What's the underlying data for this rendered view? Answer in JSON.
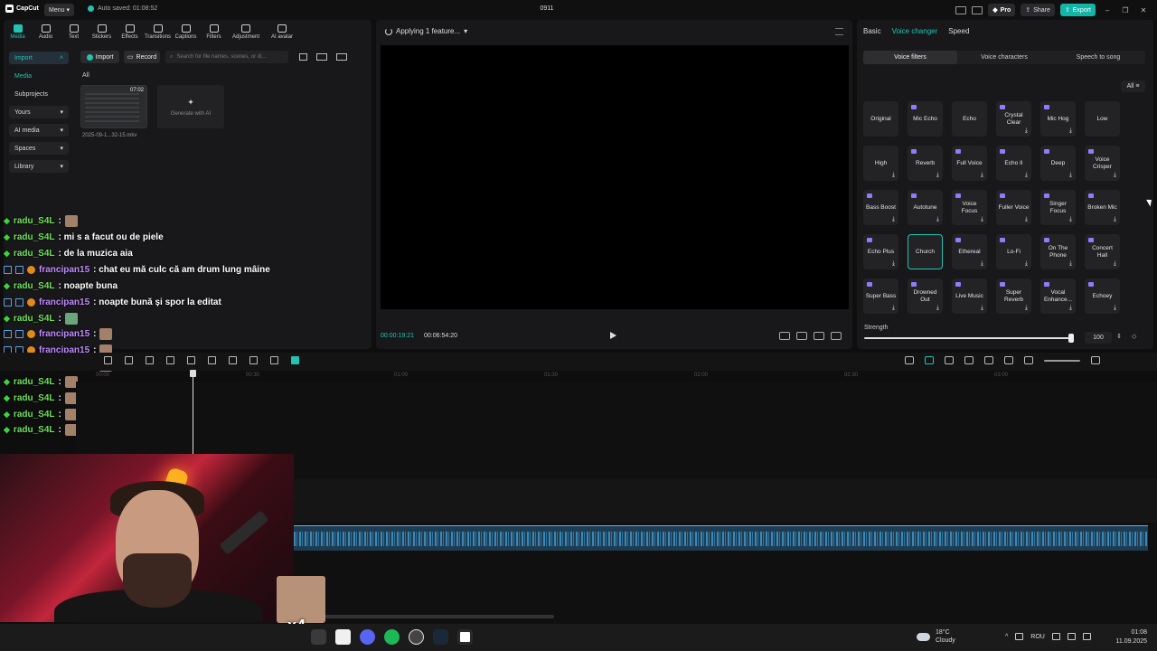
{
  "titlebar": {
    "app_name": "CapCut",
    "menu_label": "Menu",
    "autosave": "Auto saved: 01:08:52",
    "project_name": "0911",
    "pro_label": "Pro",
    "share_label": "Share",
    "export_label": "Export"
  },
  "toolbar": {
    "items": [
      {
        "label": "Media"
      },
      {
        "label": "Audio"
      },
      {
        "label": "Text"
      },
      {
        "label": "Stickers"
      },
      {
        "label": "Effects"
      },
      {
        "label": "Transitions"
      },
      {
        "label": "Captions"
      },
      {
        "label": "Filters"
      },
      {
        "label": "Adjustment"
      },
      {
        "label": "AI avatar"
      }
    ]
  },
  "sidebar": {
    "items": [
      {
        "label": "Import"
      },
      {
        "label": "Media"
      },
      {
        "label": "Subprojects"
      },
      {
        "label": "Yours"
      },
      {
        "label": "AI media"
      },
      {
        "label": "Spaces"
      },
      {
        "label": "Library"
      }
    ]
  },
  "media": {
    "import_label": "Import",
    "record_label": "Record",
    "search_placeholder": "Search for file names, scenes, or di...",
    "all_label": "All",
    "clip_duration": "07:02",
    "clip_name": "2025-09-1...32-15.mkv",
    "generate_label": "Generate with AI"
  },
  "chat": [
    {
      "user": "radu_S4L",
      "text": ":",
      "type": "radu"
    },
    {
      "user": "radu_S4L",
      "text": ": mi s a facut ou de piele",
      "type": "radu"
    },
    {
      "user": "radu_S4L",
      "text": ": de la muzica aia",
      "type": "radu"
    },
    {
      "user": "francipan15",
      "text": ": chat eu mă culc că am drum lung mâine",
      "type": "fran"
    },
    {
      "user": "radu_S4L",
      "text": ": noapte buna",
      "type": "radu"
    },
    {
      "user": "francipan15",
      "text": ": noapte bună și spor la editat",
      "type": "fran"
    },
    {
      "user": "radu_S4L",
      "text": ":",
      "type": "radu"
    },
    {
      "user": "francipan15",
      "text": ":",
      "type": "fran"
    },
    {
      "user": "francipan15",
      "text": ":",
      "type": "fran"
    },
    {
      "user": "francipan15",
      "text": ":",
      "type": "fran"
    },
    {
      "user": "radu_S4L",
      "text": ":",
      "type": "radu"
    },
    {
      "user": "radu_S4L",
      "text": ":",
      "type": "radu"
    },
    {
      "user": "radu_S4L",
      "text": ":",
      "type": "radu"
    },
    {
      "user": "radu_S4L",
      "text": ":",
      "type": "radu"
    }
  ],
  "player": {
    "status": "Applying 1 feature...",
    "current_time": "00:00:19:21",
    "total_time": "00:06:54:20"
  },
  "right_panel": {
    "tabs": [
      {
        "label": "Basic"
      },
      {
        "label": "Voice changer"
      },
      {
        "label": "Speed"
      }
    ],
    "subtabs": [
      {
        "label": "Voice filters"
      },
      {
        "label": "Voice characters"
      },
      {
        "label": "Speech to song"
      }
    ],
    "filter_all": "All",
    "voices": [
      {
        "label": "Original",
        "pro": false,
        "dl": false
      },
      {
        "label": "Mic Echo",
        "pro": true,
        "dl": false
      },
      {
        "label": "Echo",
        "pro": false,
        "dl": false
      },
      {
        "label": "Crystal Clear",
        "pro": true,
        "dl": true
      },
      {
        "label": "Mic Hog",
        "pro": true,
        "dl": true
      },
      {
        "label": "Low",
        "pro": false,
        "dl": false
      },
      {
        "label": "High",
        "pro": false,
        "dl": true
      },
      {
        "label": "Reverb",
        "pro": true,
        "dl": true
      },
      {
        "label": "Full Voice",
        "pro": true,
        "dl": true
      },
      {
        "label": "Echo II",
        "pro": true,
        "dl": true
      },
      {
        "label": "Deep",
        "pro": true,
        "dl": true
      },
      {
        "label": "Voice Crisper",
        "pro": true,
        "dl": true
      },
      {
        "label": "Bass Boost",
        "pro": true,
        "dl": true
      },
      {
        "label": "Autotune",
        "pro": true,
        "dl": true
      },
      {
        "label": "Voice Focus",
        "pro": true,
        "dl": true
      },
      {
        "label": "Fuller Voice",
        "pro": true,
        "dl": true
      },
      {
        "label": "Singer Focus",
        "pro": true,
        "dl": true
      },
      {
        "label": "Broken Mic",
        "pro": true,
        "dl": true
      },
      {
        "label": "Echo Plus",
        "pro": true,
        "dl": true
      },
      {
        "label": "Church",
        "pro": false,
        "dl": false,
        "selected": true
      },
      {
        "label": "Ethereal",
        "pro": true,
        "dl": true
      },
      {
        "label": "Lo-Fi",
        "pro": true,
        "dl": true
      },
      {
        "label": "On The Phone",
        "pro": true,
        "dl": true
      },
      {
        "label": "Concert Hall",
        "pro": true,
        "dl": true
      },
      {
        "label": "Super Bass",
        "pro": true,
        "dl": true
      },
      {
        "label": "Drowned Out",
        "pro": true,
        "dl": true
      },
      {
        "label": "Live Music",
        "pro": true,
        "dl": true
      },
      {
        "label": "Super Reverb",
        "pro": true,
        "dl": true
      },
      {
        "label": "Vocal Enhance...",
        "pro": true,
        "dl": true
      },
      {
        "label": "Echoey",
        "pro": true,
        "dl": true
      }
    ],
    "strength_label": "Strength",
    "strength_value": "100",
    "strength_fraction": 1.0
  },
  "timeline": {
    "ticks": [
      "00:00",
      "00:30",
      "01:00",
      "01:30",
      "02:00",
      "02:30",
      "03:00"
    ]
  },
  "overlay": {
    "multiplier": "x4"
  },
  "taskbar": {
    "temperature": "18°C",
    "weather": "Cloudy",
    "language": "ROU",
    "time": "01:08",
    "date": "11.09.2025"
  },
  "colors": {
    "accent": "#23c3b2",
    "pro_gem": "#8c7dff",
    "chat_radu": "#6fe05a",
    "chat_fran": "#c089ff"
  }
}
